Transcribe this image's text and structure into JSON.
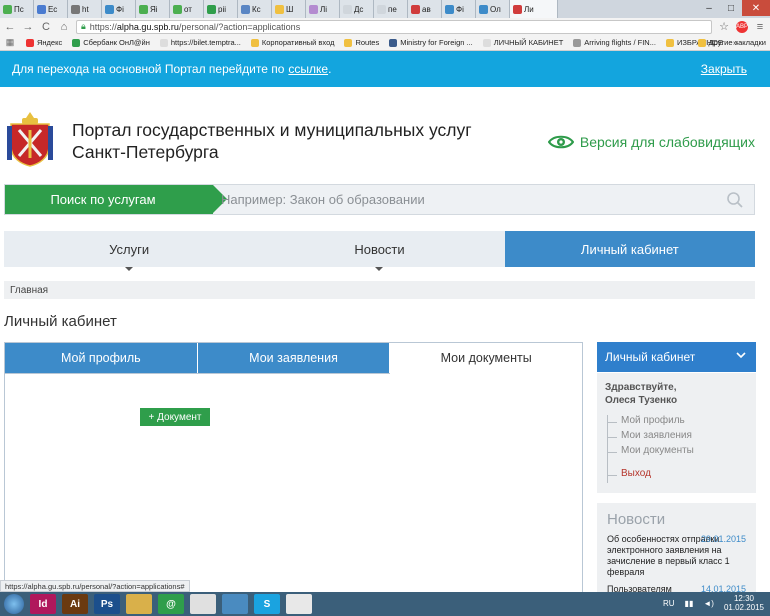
{
  "browser": {
    "tabs": [
      {
        "label": "Пс",
        "color": "#4caf50"
      },
      {
        "label": "Ес",
        "color": "#4a7bd0"
      },
      {
        "label": "ht",
        "color": "#777"
      },
      {
        "label": "Фі",
        "color": "#3d8bc9"
      },
      {
        "label": "Яі",
        "color": "#4caf50"
      },
      {
        "label": "от",
        "color": "#4caf50"
      },
      {
        "label": "ріі",
        "color": "#2f9e4b"
      },
      {
        "label": "Кс",
        "color": "#5a86c4"
      },
      {
        "label": "Ш",
        "color": "#f0c040"
      },
      {
        "label": "Лі",
        "color": "#b48bd0"
      },
      {
        "label": "Дс",
        "color": "#d0d6dc"
      },
      {
        "label": "пе",
        "color": "#d0d6dc"
      },
      {
        "label": "ав",
        "color": "#d03c3c"
      },
      {
        "label": "Фі",
        "color": "#3d8bc9"
      },
      {
        "label": "Ол",
        "color": "#3d8bc9"
      },
      {
        "label": "Ли",
        "color": "#d03c3c"
      }
    ],
    "url_scheme": "https://",
    "url_host": "alpha.gu.spb.ru",
    "url_path": "/personal/?action=applications",
    "bookmarks": [
      "Яндекс",
      "Сбербанк ОнЛ@йн",
      "https://bilet.temptra...",
      "Корпоративный вход",
      "Routes",
      "Ministry for Foreign ...",
      "ЛИЧНЫЙ КАБИНЕТ",
      "Arriving flights / FIN...",
      "ИЗБРАННОЕ"
    ],
    "bookmarks_more": "»",
    "other_bookmarks": "Другие закладки",
    "status_url": "https://alpha.gu.spb.ru/personal/?action=applications#"
  },
  "notice": {
    "text": "Для перехода на основной Портал перейдите по",
    "link": "ссылке",
    "period": ".",
    "close": "Закрыть"
  },
  "header": {
    "title_line1": "Портал государственных и муниципальных услуг",
    "title_line2": "Санкт-Петербурга",
    "accessible_version": "Версия для слабовидящих"
  },
  "search": {
    "button": "Поиск по услугам",
    "placeholder": "Например: Закон об образовании"
  },
  "nav": {
    "items": [
      "Услуги",
      "Новости",
      "Личный кабинет"
    ]
  },
  "breadcrumb": {
    "home": "Главная"
  },
  "page_title": "Личный кабинет",
  "content": {
    "tabs": [
      "Мой профиль",
      "Мои заявления",
      "Мои документы"
    ],
    "add_document": "+ Документ"
  },
  "sidebar": {
    "title": "Личный кабинет",
    "greeting_line1": "Здравствуйте,",
    "greeting_line2": "Олеся Тузенко",
    "menu": [
      "Мой профиль",
      "Мои заявления",
      "Мои документы"
    ],
    "exit": "Выход"
  },
  "news": {
    "title": "Новости",
    "items": [
      {
        "date": "29.01.2015",
        "text": "Об особенностях отправки электронного заявления на зачисление в первый класс 1 февраля"
      },
      {
        "date": "14.01.2015",
        "text": "Пользователям"
      }
    ]
  },
  "taskbar": {
    "apps": [
      {
        "name": "indesign",
        "label": "Id",
        "color": "#b0185c"
      },
      {
        "name": "illustrator",
        "label": "Ai",
        "color": "#6b3a10"
      },
      {
        "name": "photoshop",
        "label": "Ps",
        "color": "#1c4f8c"
      },
      {
        "name": "explorer",
        "label": "",
        "color": "#d9b04a"
      },
      {
        "name": "qip",
        "label": "@",
        "color": "#2f9e4b"
      },
      {
        "name": "chrome",
        "label": "",
        "color": "#e0e0e0"
      },
      {
        "name": "app-window",
        "label": "",
        "color": "#4a8bc0"
      },
      {
        "name": "skype",
        "label": "S",
        "color": "#1aa3e0"
      },
      {
        "name": "document",
        "label": "",
        "color": "#e8e8e8"
      }
    ],
    "lang": "RU",
    "time": "12:30",
    "date": "01.02.2015"
  }
}
